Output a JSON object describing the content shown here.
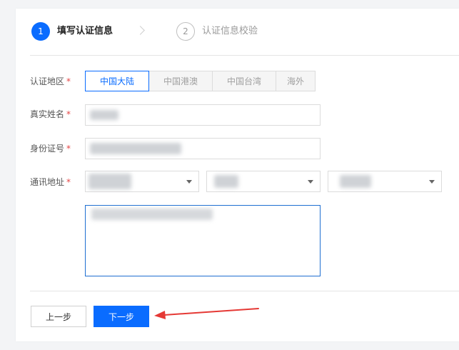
{
  "steps": [
    {
      "number": "1",
      "label": "填写认证信息"
    },
    {
      "number": "2",
      "label": "认证信息校验"
    }
  ],
  "form": {
    "region": {
      "label": "认证地区",
      "required_mark": "*",
      "options": [
        "中国大陆",
        "中国港澳",
        "中国台湾",
        "海外"
      ],
      "selected": "中国大陆"
    },
    "name": {
      "label": "真实姓名",
      "required_mark": "*"
    },
    "id_number": {
      "label": "身份证号",
      "required_mark": "*"
    },
    "address": {
      "label": "通讯地址",
      "required_mark": "*"
    }
  },
  "buttons": {
    "prev": "上一步",
    "next": "下一步"
  },
  "colors": {
    "accent": "#0a6cff",
    "required": "#e54545",
    "annotation_arrow": "#e53935"
  },
  "icons": {
    "step_chevron": "chevron-right-icon",
    "select_caret": "caret-down-icon",
    "annotation": "red-arrow"
  }
}
